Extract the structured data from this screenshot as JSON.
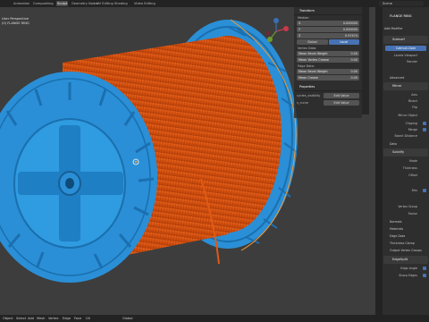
{
  "topbar": {
    "tabs": [
      "Animation",
      "Compositing",
      "Sculpt",
      "Geometry Nodes",
      "UV Editing",
      "Shading",
      "Video Editing"
    ],
    "active_tab": "Sculpt",
    "scene": "Scene"
  },
  "viewport_overlay": {
    "line1": "User Perspective",
    "line2": "(0) FLANGE RING"
  },
  "npanel": {
    "transform_title": "Transform",
    "median_label": "Median:",
    "fields": [
      {
        "axis": "X",
        "value": "0.000000"
      },
      {
        "axis": "Y",
        "value": "0.000000"
      },
      {
        "axis": "Z",
        "value": "0.97474"
      }
    ],
    "global_btn": "Global",
    "local_btn": "Local",
    "vertex_data_label": "Vertex Data:",
    "vertex_fields": [
      {
        "label": "Mean Bevel Weight",
        "value": "0.00"
      },
      {
        "label": "Mean Vertex Crease",
        "value": "0.00"
      }
    ],
    "edge_data_label": "Edge Data:",
    "edge_fields": [
      {
        "label": "Mean Bevel Weight",
        "value": "0.00"
      },
      {
        "label": "Mean Crease",
        "value": "0.00"
      }
    ],
    "properties_title": "Properties",
    "props": [
      {
        "key": "cycles_visibility",
        "val": "Edit Value"
      },
      {
        "key": "s_curve",
        "val": "Edit Value"
      }
    ]
  },
  "props_editor": {
    "object_name": "FLANGE RING",
    "add_modifier": "Add Modifier",
    "subsurf": {
      "name": "Subsurf",
      "mode_btn": "Catmull-Clark",
      "levels_label": "Levels Viewport",
      "render_label": "Render",
      "advanced": "Advanced"
    },
    "mirror": {
      "name": "Mirror",
      "axis": "Axis",
      "bisect": "Bisect",
      "flip": "Flip",
      "mirror_object": "Mirror Object",
      "clipping": "Clipping",
      "merge": "Merge",
      "bisect_distance": "Bisect Distance",
      "data": "Data"
    },
    "solidify": {
      "name": "Solidify",
      "mode": "Mode",
      "thickness": "Thickness",
      "offset": "Offset",
      "rim": "Rim",
      "vertex_group": "Vertex Group",
      "factor": "Factor",
      "sections": [
        "Normals",
        "Materials",
        "Edge Data",
        "Thickness Clamp",
        "Output Vertex Groups"
      ]
    },
    "edge_split": {
      "name": "EdgeSplit",
      "edge_angle": "Edge Angle",
      "sharp_edges": "Sharp Edges"
    }
  },
  "bottombar": {
    "menus": [
      "Object",
      "Select",
      "Add",
      "Mesh",
      "Vertex",
      "Edge",
      "Face",
      "UV"
    ],
    "orientation": "Global"
  },
  "colors": {
    "spool_blue": "#2a8fd6",
    "wire_orange": "#e05a14",
    "accent": "#4772b3"
  }
}
